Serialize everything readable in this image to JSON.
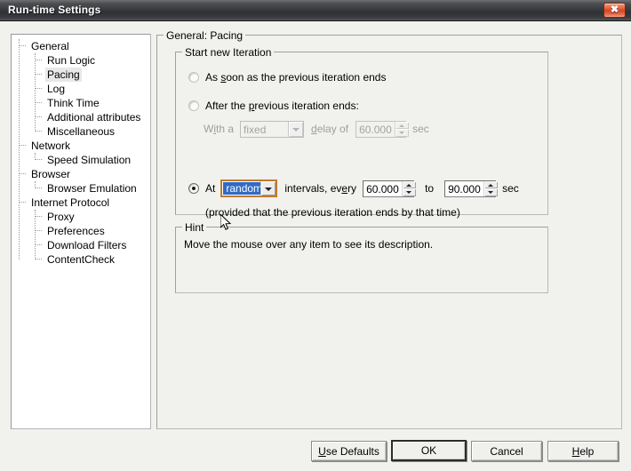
{
  "window": {
    "title": "Run-time Settings",
    "close_label": "✖"
  },
  "tree": {
    "nodes": [
      {
        "label": "General",
        "level": 0,
        "selected": false
      },
      {
        "label": "Run Logic",
        "level": 1,
        "selected": false
      },
      {
        "label": "Pacing",
        "level": 1,
        "selected": true
      },
      {
        "label": "Log",
        "level": 1,
        "selected": false
      },
      {
        "label": "Think Time",
        "level": 1,
        "selected": false
      },
      {
        "label": "Additional attributes",
        "level": 1,
        "selected": false
      },
      {
        "label": "Miscellaneous",
        "level": 1,
        "selected": false
      },
      {
        "label": "Network",
        "level": 0,
        "selected": false
      },
      {
        "label": "Speed Simulation",
        "level": 1,
        "selected": false
      },
      {
        "label": "Browser",
        "level": 0,
        "selected": false
      },
      {
        "label": "Browser Emulation",
        "level": 1,
        "selected": false
      },
      {
        "label": "Internet Protocol",
        "level": 0,
        "selected": false
      },
      {
        "label": "Proxy",
        "level": 1,
        "selected": false
      },
      {
        "label": "Preferences",
        "level": 1,
        "selected": false
      },
      {
        "label": "Download Filters",
        "level": 1,
        "selected": false
      },
      {
        "label": "ContentCheck",
        "level": 1,
        "selected": false
      }
    ]
  },
  "panel": {
    "title": "General: Pacing",
    "start_group_title": "Start new Iteration",
    "option1": {
      "label_pre": "As ",
      "label_accel": "s",
      "label_post": "oon as the previous iteration ends",
      "selected": false
    },
    "option2": {
      "label_pre": "After the ",
      "label_accel": "p",
      "label_post": "revious iteration ends:",
      "selected": false,
      "with_a_pre": "W",
      "with_a_accel": "i",
      "with_a_post": "th a",
      "combo_value": "fixed",
      "delay_of_pre": "",
      "delay_of_accel": "d",
      "delay_of_post": "elay of",
      "spin_value": "60.000",
      "unit": "sec",
      "enabled": false
    },
    "option3": {
      "label_pre": "At",
      "label_accel": "t",
      "selected": true,
      "combo_value": "random",
      "mid_pre": "intervals, ev",
      "mid_accel": "e",
      "mid_post": "ry",
      "spin_from": "60.000",
      "to_label": "to",
      "spin_to": "90.000",
      "unit": "sec",
      "note": "(provided that the previous iteration ends by that time)"
    },
    "hint_group_title": "Hint",
    "hint_text": "Move the mouse over any item to see its description."
  },
  "buttons": {
    "use_defaults_pre": "",
    "use_defaults_accel": "U",
    "use_defaults_post": "se Defaults",
    "ok": "OK",
    "cancel": "Cancel",
    "help_pre": "",
    "help_accel": "H",
    "help_post": "elp"
  },
  "colors": {
    "titlebar_dark": "#3a3c3f",
    "close_red": "#d3452a",
    "selection_blue": "#316ac5",
    "focus_orange": "#c07a2d",
    "dialog_face": "#f1f1ee",
    "disabled_text": "#9e9e9e"
  }
}
